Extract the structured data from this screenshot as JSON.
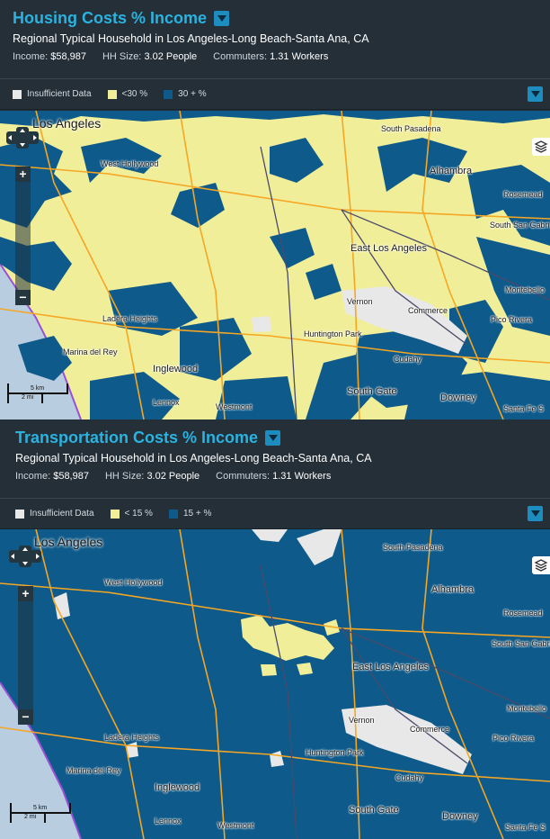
{
  "panels": [
    {
      "title": "Housing Costs % Income",
      "subtitle": "Regional Typical Household in Los Angeles-Long Beach-Santa Ana, CA",
      "income_label": "Income:",
      "income_value": "$58,987",
      "hh_label": "HH Size:",
      "hh_value": "3.02 People",
      "commuters_label": "Commuters:",
      "commuters_value": "1.31 Workers",
      "legend": [
        {
          "label": "Insufficient Data",
          "color": "#e8e8e8"
        },
        {
          "label": "<30 %",
          "color": "#f1ee9a"
        },
        {
          "label": "30 + %",
          "color": "#0e5a8a"
        }
      ],
      "map": {
        "base_color": "#f1ee9a",
        "overlay_color": "#0e5a8a",
        "scale_km": "5 km",
        "scale_mi": "2 mi",
        "labels": [
          "Los Angeles",
          "South Pasadena",
          "Alhambra",
          "Rosemead",
          "West Hollywood",
          "South San Gabri",
          "East Los Angeles",
          "Montebello",
          "Ladera Heights",
          "Vernon",
          "Commerce",
          "Pico Rivera",
          "Marina del Rey",
          "Huntington Park",
          "Inglewood",
          "Cudahy",
          "South Gate",
          "Downey",
          "Lennox",
          "Westmont",
          "Santa Fe S"
        ]
      }
    },
    {
      "title": "Transportation Costs % Income",
      "subtitle": "Regional Typical Household in Los Angeles-Long Beach-Santa Ana, CA",
      "income_label": "Income:",
      "income_value": "$58,987",
      "hh_label": "HH Size:",
      "hh_value": "3.02 People",
      "commuters_label": "Commuters:",
      "commuters_value": "1.31 Workers",
      "legend": [
        {
          "label": "Insufficient Data",
          "color": "#e8e8e8"
        },
        {
          "label": "< 15 %",
          "color": "#f1ee9a"
        },
        {
          "label": "15 + %",
          "color": "#0e5a8a"
        }
      ],
      "map": {
        "base_color": "#0e5a8a",
        "overlay_color": "#f1ee9a",
        "scale_km": "5 km",
        "scale_mi": "2 mi",
        "labels": [
          "Los Angeles",
          "South Pasadena",
          "Alhambra",
          "Rosemead",
          "West Hollywood",
          "South San Gabri",
          "East Los Angeles",
          "Montebello",
          "Ladera Heights",
          "Vernon",
          "Commerce",
          "Pico Rivera",
          "Marina del Rey",
          "Huntington Park",
          "Inglewood",
          "Cudahy",
          "South Gate",
          "Downey",
          "Lennox",
          "Westmont",
          "Santa Fe S"
        ]
      }
    }
  ]
}
